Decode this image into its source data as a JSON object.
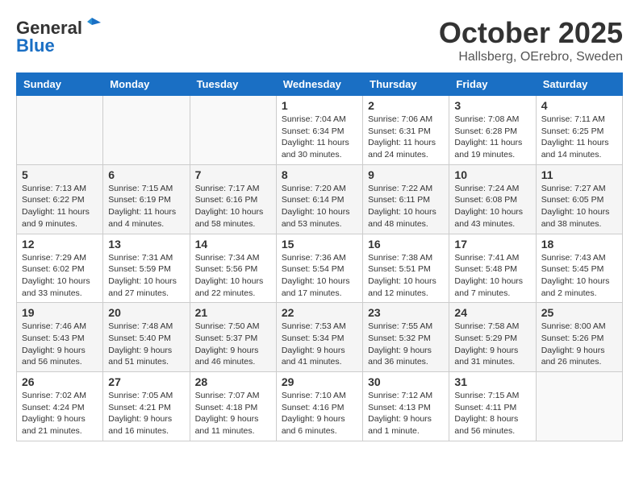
{
  "header": {
    "logo_general": "General",
    "logo_blue": "Blue",
    "month": "October 2025",
    "location": "Hallsberg, OErebro, Sweden"
  },
  "weekdays": [
    "Sunday",
    "Monday",
    "Tuesday",
    "Wednesday",
    "Thursday",
    "Friday",
    "Saturday"
  ],
  "weeks": [
    [
      {
        "day": "",
        "info": ""
      },
      {
        "day": "",
        "info": ""
      },
      {
        "day": "",
        "info": ""
      },
      {
        "day": "1",
        "info": "Sunrise: 7:04 AM\nSunset: 6:34 PM\nDaylight: 11 hours\nand 30 minutes."
      },
      {
        "day": "2",
        "info": "Sunrise: 7:06 AM\nSunset: 6:31 PM\nDaylight: 11 hours\nand 24 minutes."
      },
      {
        "day": "3",
        "info": "Sunrise: 7:08 AM\nSunset: 6:28 PM\nDaylight: 11 hours\nand 19 minutes."
      },
      {
        "day": "4",
        "info": "Sunrise: 7:11 AM\nSunset: 6:25 PM\nDaylight: 11 hours\nand 14 minutes."
      }
    ],
    [
      {
        "day": "5",
        "info": "Sunrise: 7:13 AM\nSunset: 6:22 PM\nDaylight: 11 hours\nand 9 minutes."
      },
      {
        "day": "6",
        "info": "Sunrise: 7:15 AM\nSunset: 6:19 PM\nDaylight: 11 hours\nand 4 minutes."
      },
      {
        "day": "7",
        "info": "Sunrise: 7:17 AM\nSunset: 6:16 PM\nDaylight: 10 hours\nand 58 minutes."
      },
      {
        "day": "8",
        "info": "Sunrise: 7:20 AM\nSunset: 6:14 PM\nDaylight: 10 hours\nand 53 minutes."
      },
      {
        "day": "9",
        "info": "Sunrise: 7:22 AM\nSunset: 6:11 PM\nDaylight: 10 hours\nand 48 minutes."
      },
      {
        "day": "10",
        "info": "Sunrise: 7:24 AM\nSunset: 6:08 PM\nDaylight: 10 hours\nand 43 minutes."
      },
      {
        "day": "11",
        "info": "Sunrise: 7:27 AM\nSunset: 6:05 PM\nDaylight: 10 hours\nand 38 minutes."
      }
    ],
    [
      {
        "day": "12",
        "info": "Sunrise: 7:29 AM\nSunset: 6:02 PM\nDaylight: 10 hours\nand 33 minutes."
      },
      {
        "day": "13",
        "info": "Sunrise: 7:31 AM\nSunset: 5:59 PM\nDaylight: 10 hours\nand 27 minutes."
      },
      {
        "day": "14",
        "info": "Sunrise: 7:34 AM\nSunset: 5:56 PM\nDaylight: 10 hours\nand 22 minutes."
      },
      {
        "day": "15",
        "info": "Sunrise: 7:36 AM\nSunset: 5:54 PM\nDaylight: 10 hours\nand 17 minutes."
      },
      {
        "day": "16",
        "info": "Sunrise: 7:38 AM\nSunset: 5:51 PM\nDaylight: 10 hours\nand 12 minutes."
      },
      {
        "day": "17",
        "info": "Sunrise: 7:41 AM\nSunset: 5:48 PM\nDaylight: 10 hours\nand 7 minutes."
      },
      {
        "day": "18",
        "info": "Sunrise: 7:43 AM\nSunset: 5:45 PM\nDaylight: 10 hours\nand 2 minutes."
      }
    ],
    [
      {
        "day": "19",
        "info": "Sunrise: 7:46 AM\nSunset: 5:43 PM\nDaylight: 9 hours\nand 56 minutes."
      },
      {
        "day": "20",
        "info": "Sunrise: 7:48 AM\nSunset: 5:40 PM\nDaylight: 9 hours\nand 51 minutes."
      },
      {
        "day": "21",
        "info": "Sunrise: 7:50 AM\nSunset: 5:37 PM\nDaylight: 9 hours\nand 46 minutes."
      },
      {
        "day": "22",
        "info": "Sunrise: 7:53 AM\nSunset: 5:34 PM\nDaylight: 9 hours\nand 41 minutes."
      },
      {
        "day": "23",
        "info": "Sunrise: 7:55 AM\nSunset: 5:32 PM\nDaylight: 9 hours\nand 36 minutes."
      },
      {
        "day": "24",
        "info": "Sunrise: 7:58 AM\nSunset: 5:29 PM\nDaylight: 9 hours\nand 31 minutes."
      },
      {
        "day": "25",
        "info": "Sunrise: 8:00 AM\nSunset: 5:26 PM\nDaylight: 9 hours\nand 26 minutes."
      }
    ],
    [
      {
        "day": "26",
        "info": "Sunrise: 7:02 AM\nSunset: 4:24 PM\nDaylight: 9 hours\nand 21 minutes."
      },
      {
        "day": "27",
        "info": "Sunrise: 7:05 AM\nSunset: 4:21 PM\nDaylight: 9 hours\nand 16 minutes."
      },
      {
        "day": "28",
        "info": "Sunrise: 7:07 AM\nSunset: 4:18 PM\nDaylight: 9 hours\nand 11 minutes."
      },
      {
        "day": "29",
        "info": "Sunrise: 7:10 AM\nSunset: 4:16 PM\nDaylight: 9 hours\nand 6 minutes."
      },
      {
        "day": "30",
        "info": "Sunrise: 7:12 AM\nSunset: 4:13 PM\nDaylight: 9 hours\nand 1 minute."
      },
      {
        "day": "31",
        "info": "Sunrise: 7:15 AM\nSunset: 4:11 PM\nDaylight: 8 hours\nand 56 minutes."
      },
      {
        "day": "",
        "info": ""
      }
    ]
  ]
}
